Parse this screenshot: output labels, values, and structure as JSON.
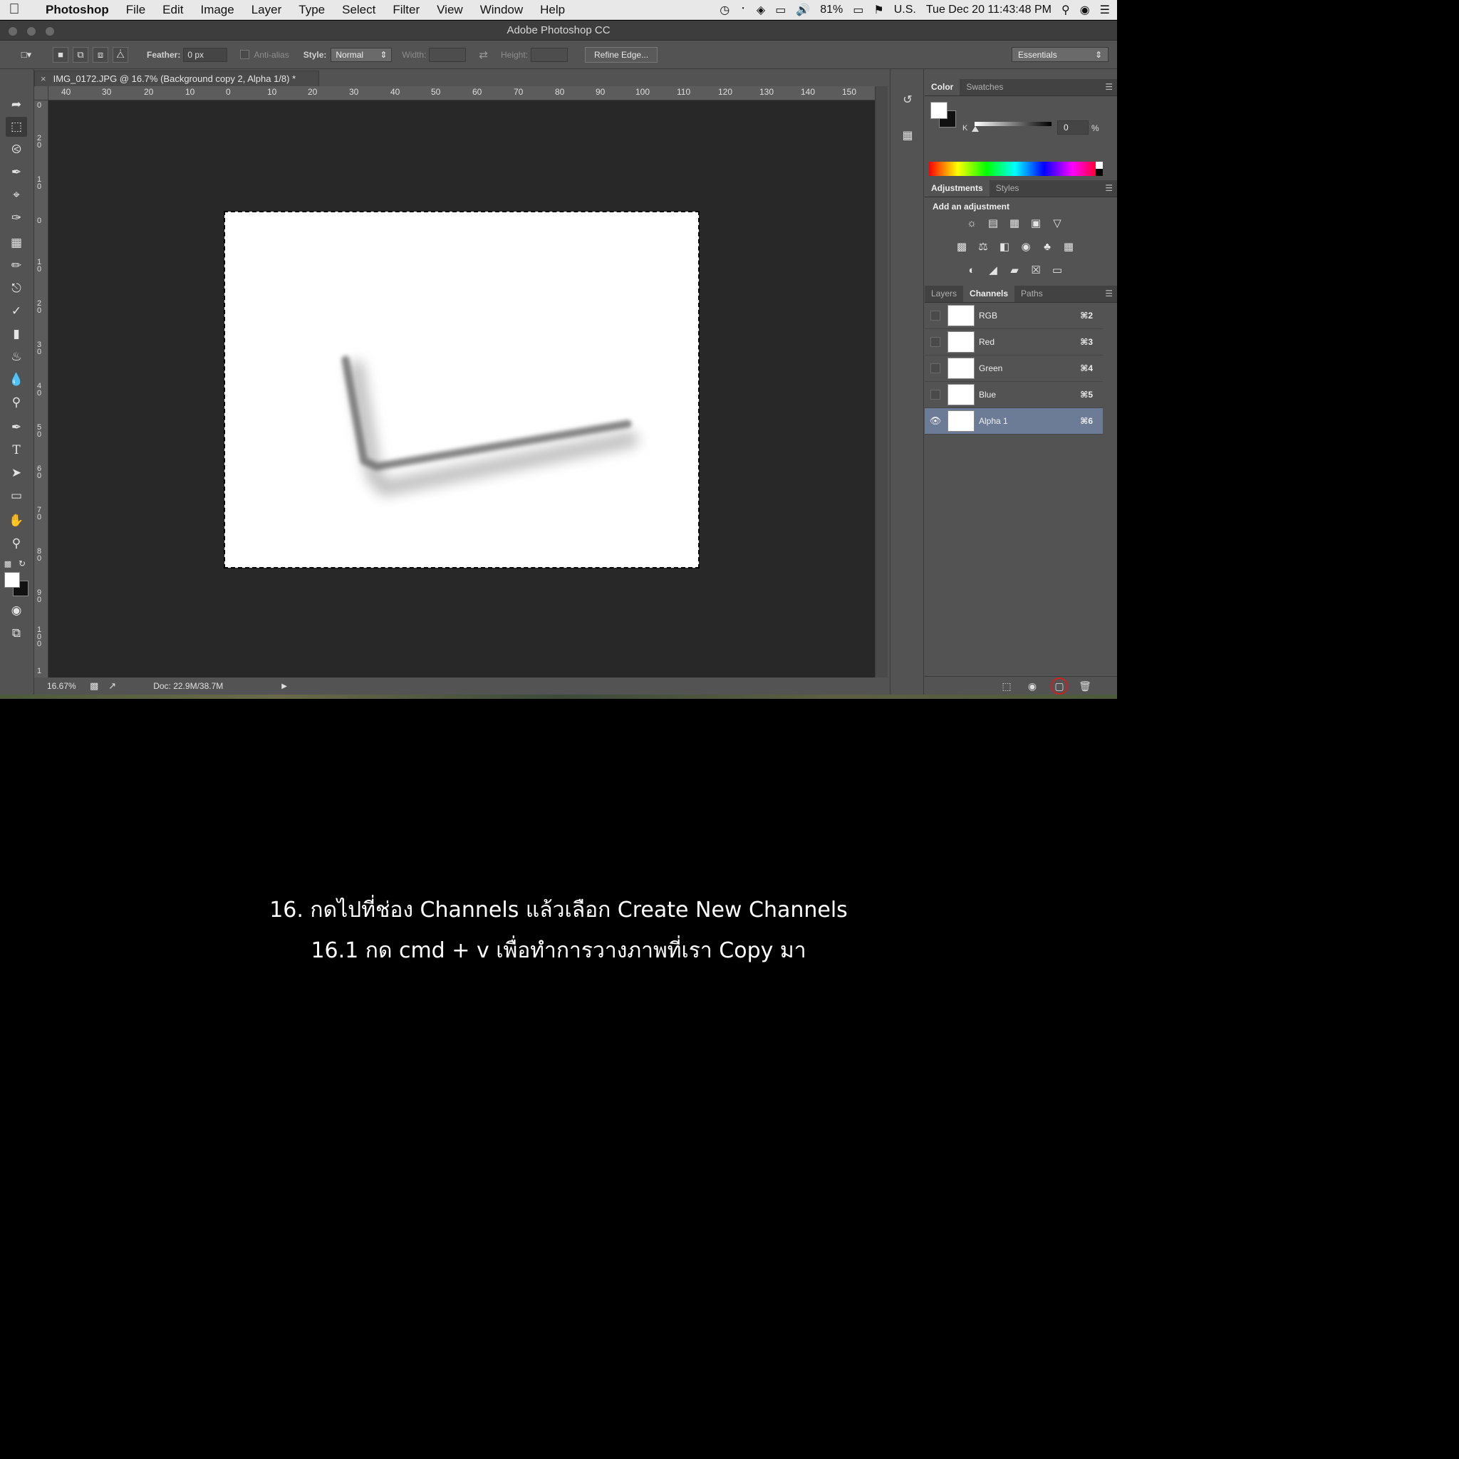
{
  "menubar": {
    "app_name": "Photoshop",
    "items": [
      "File",
      "Edit",
      "Image",
      "Layer",
      "Type",
      "Select",
      "Filter",
      "View",
      "Window",
      "Help"
    ],
    "battery": "81%",
    "input_source": "U.S.",
    "clock": "Tue Dec 20  11:43:48 PM"
  },
  "window": {
    "title": "Adobe Photoshop CC"
  },
  "options_bar": {
    "feather_label": "Feather:",
    "feather_value": "0 px",
    "antialias_label": "Anti-alias",
    "style_label": "Style:",
    "style_value": "Normal",
    "width_label": "Width:",
    "height_label": "Height:",
    "refine_edge": "Refine Edge...",
    "workspace": "Essentials"
  },
  "document": {
    "tab_title": "IMG_0172.JPG @ 16.7% (Background copy 2, Alpha 1/8) *",
    "ruler_h": [
      "40",
      "30",
      "20",
      "10",
      "0",
      "10",
      "20",
      "30",
      "40",
      "50",
      "60",
      "70",
      "80",
      "90",
      "100",
      "110",
      "120",
      "130",
      "140",
      "150"
    ],
    "ruler_v": [
      "0",
      "20",
      "10",
      "0",
      "10",
      "20",
      "30",
      "40",
      "50",
      "60",
      "70",
      "80",
      "90",
      "100",
      "1"
    ],
    "zoom": "16.67%",
    "doc_size": "Doc: 22.9M/38.7M"
  },
  "panels": {
    "color_tabs": [
      "Color",
      "Swatches"
    ],
    "k_label": "K",
    "k_value": "0",
    "k_unit": "%",
    "adjust_tabs": [
      "Adjustments",
      "Styles"
    ],
    "adjust_title": "Add an adjustment",
    "channel_tabs": [
      "Layers",
      "Channels",
      "Paths"
    ],
    "channels": [
      {
        "name": "RGB",
        "shortcut": "⌘2"
      },
      {
        "name": "Red",
        "shortcut": "⌘3"
      },
      {
        "name": "Green",
        "shortcut": "⌘4"
      },
      {
        "name": "Blue",
        "shortcut": "⌘5"
      },
      {
        "name": "Alpha 1",
        "shortcut": "⌘6"
      }
    ]
  },
  "caption": {
    "line1": "16. กดไปที่ช่อง Channels แล้วเลือก Create New Channels",
    "line2": "16.1 กด cmd + v เพื่อทำการวางภาพที่เรา Copy มา"
  },
  "colors": {
    "selected_channel": "#6d7c96",
    "canvas_bg": "#282828",
    "panel_bg": "#535353",
    "highlight_ring": "#d02020"
  }
}
